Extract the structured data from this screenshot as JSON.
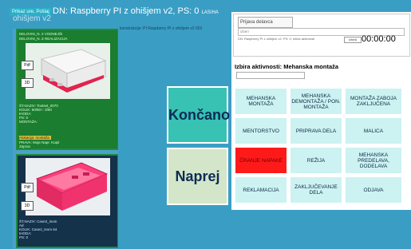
{
  "window": {
    "badge": "Prikaz ure, Pošlaj",
    "title": "DN: Raspberry PI z ohišjem v2, PS: 0",
    "title_suffix": "LAS/HA",
    "ghost_title": "ohišjem v2",
    "ghost_note": "konstrukcije: PI Raspberry PI z ohišjem v2 001"
  },
  "cards": [
    {
      "header": [
        "DELOVNI_N. 2 VODNEJŠI",
        "DELOVNI_N. Z REALIZACIJA"
      ],
      "tag_top": "Pdf",
      "tag_bottom": "3D",
      "lines": [
        "ŠT.NAZIV: Toolset_0070",
        "KOLIK: 50/50+: 3/50",
        "IHODA:",
        "PS: 0",
        "MONTAŽA:"
      ],
      "highlight": "Alokacija: montaža",
      "footer": [
        "PRAVA: Moje Napr. Kopir",
        "Zaprav"
      ]
    },
    {
      "header": [],
      "tag_top": "Pdf",
      "tag_bottom": "3D",
      "lines": [
        "ŠT.NAZIV: Case2_Isom",
        "Ad",
        "KOLIK: Case2_Isom 64",
        "IHODA:",
        "PS: 0"
      ],
      "highlight": "",
      "footer": []
    }
  ],
  "actions": {
    "done_label": "Končano",
    "next_label": "Naprej"
  },
  "right_panel": {
    "tab_label": "Prijava delavca",
    "dropdown_placeholder": "izberi",
    "description": "DN: Raspberry PI z ohišjem v2, PS: 0, izbira aktivnosti",
    "small_button": "Izbriši",
    "timer": "00:00:00",
    "activity_title": "Izbira aktivnosti: Mehanska montaža"
  },
  "activities": [
    "MEHANSKA MONTAŽA",
    "MEHANSKA DEMONTAŽA / PON. MONTAŽA",
    "MONTAŽA ZABOJA ZAKLJUČENA",
    "MENTORSTVO",
    "PRIPRAVA DELA",
    "MALICA",
    "ČRANJE NAPAKE",
    "REŽIJA",
    "MEHANSKA PREDELAVA, DODELAVA",
    "REKLAMACIJA",
    "ZAKLJUČEVANJE DELA",
    "ODJAVA"
  ],
  "colors": {
    "background": "#3a9ec4",
    "card_green": "#1b7d2f",
    "done_button": "#37c2b4",
    "next_button": "#d3e6c9",
    "cell": "#cdf2f2",
    "cell_active": "#ff1a1a"
  }
}
